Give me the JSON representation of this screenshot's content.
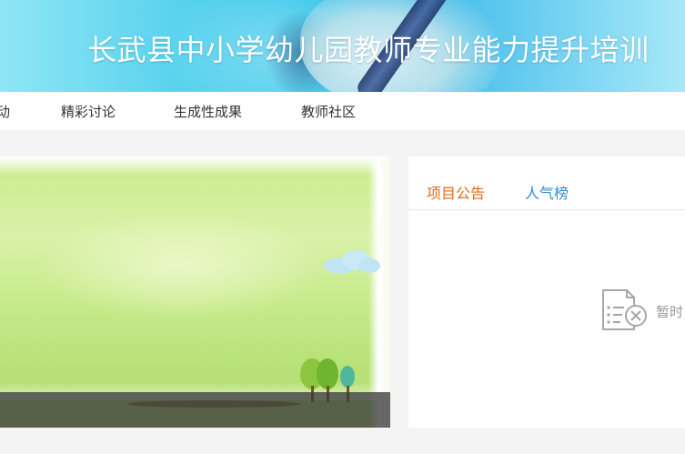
{
  "banner": {
    "title": "长武县中小学幼儿园教师专业能力提升培训"
  },
  "nav": {
    "items": [
      {
        "label": "动"
      },
      {
        "label": "精彩讨论"
      },
      {
        "label": "生成性成果"
      },
      {
        "label": "教师社区"
      }
    ]
  },
  "panel": {
    "tabs": [
      {
        "label": "项目公告",
        "active": true
      },
      {
        "label": "人气榜",
        "active": false
      }
    ],
    "empty_icon": "no-content-document-icon",
    "empty_text": "暂时"
  },
  "colors": {
    "accent_orange": "#e8671b",
    "link_blue": "#2a8ed6",
    "nav_text": "#333333",
    "muted_text": "#999999",
    "page_bg": "#f4f4f4"
  }
}
